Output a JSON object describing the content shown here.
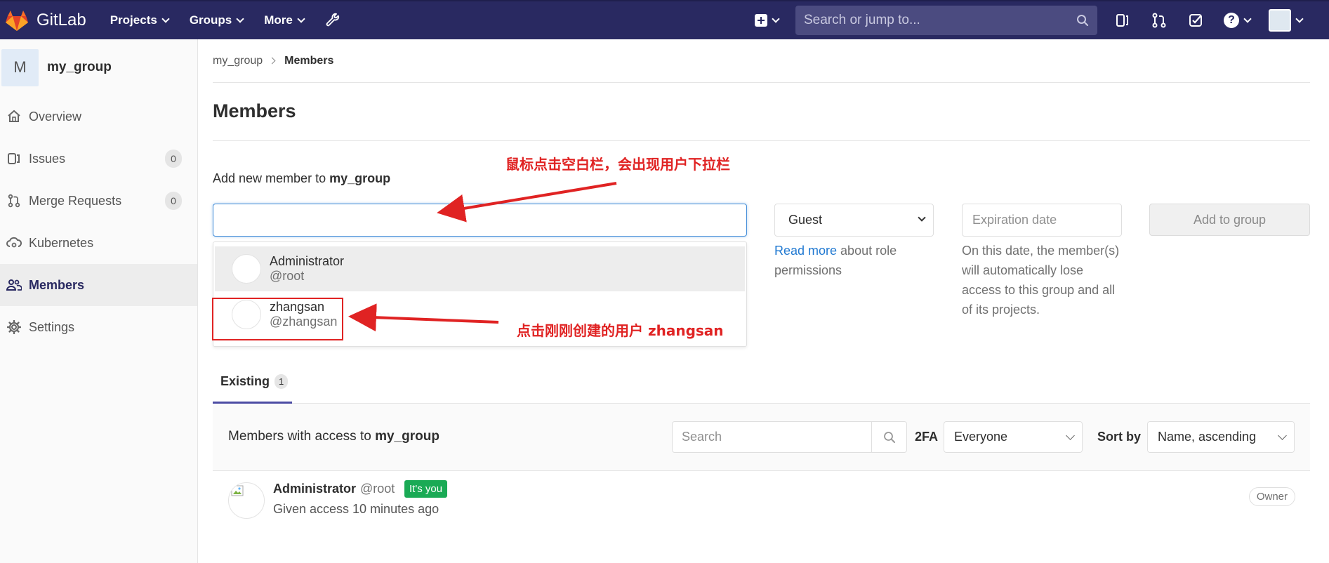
{
  "navbar": {
    "brand": "GitLab",
    "menu": [
      {
        "label": "Projects",
        "name": "nav-projects"
      },
      {
        "label": "Groups",
        "name": "nav-groups"
      },
      {
        "label": "More",
        "name": "nav-more"
      }
    ],
    "search_placeholder": "Search or jump to...",
    "help_glyph": "?"
  },
  "sidebar": {
    "group_initial": "M",
    "group_name": "my_group",
    "items": [
      {
        "label": "Overview",
        "icon": "home-icon"
      },
      {
        "label": "Issues",
        "icon": "issues-icon",
        "badge": "0"
      },
      {
        "label": "Merge Requests",
        "icon": "merge-request-icon",
        "badge": "0"
      },
      {
        "label": "Kubernetes",
        "icon": "cloud-gear-icon"
      },
      {
        "label": "Members",
        "icon": "users-icon",
        "active": true
      },
      {
        "label": "Settings",
        "icon": "gear-icon"
      }
    ]
  },
  "breadcrumb": {
    "parent": "my_group",
    "current": "Members"
  },
  "page_title": "Members",
  "add_member": {
    "label_prefix": "Add new member to ",
    "group": "my_group",
    "input_value": "",
    "suggestions": [
      {
        "name": "Administrator",
        "username": "@root",
        "highlighted": true
      },
      {
        "name": "zhangsan",
        "username": "@zhangsan",
        "highlighted": false
      }
    ],
    "role_value": "Guest",
    "role_help_link": "Read more",
    "role_help_text": " about role permissions",
    "expiration_placeholder": "Expiration date",
    "expiration_help": "On this date, the member(s) will automatically lose access to this group and all of its projects.",
    "submit_label": "Add to group"
  },
  "tabs": {
    "existing_label": "Existing",
    "existing_count": "1"
  },
  "members_list": {
    "title_prefix": "Members with access to ",
    "group": "my_group",
    "search_placeholder": "Search",
    "twofa_label": "2FA",
    "twofa_value": "Everyone",
    "sort_label": "Sort by",
    "sort_value": "Name, ascending",
    "rows": [
      {
        "name": "Administrator",
        "username": "@root",
        "badge": "It's you",
        "access": "Given access 10 minutes ago",
        "role": "Owner"
      }
    ]
  },
  "annotations": {
    "top_note": "鼠标点击空白栏，会出现用户下拉栏",
    "bottom_note": "点击刚刚创建的用户 zhangsan"
  },
  "colors": {
    "navbar_bg": "#292961",
    "link": "#1f78d1",
    "annotation_red": "#e02323",
    "badge_green": "#1aaa55"
  }
}
